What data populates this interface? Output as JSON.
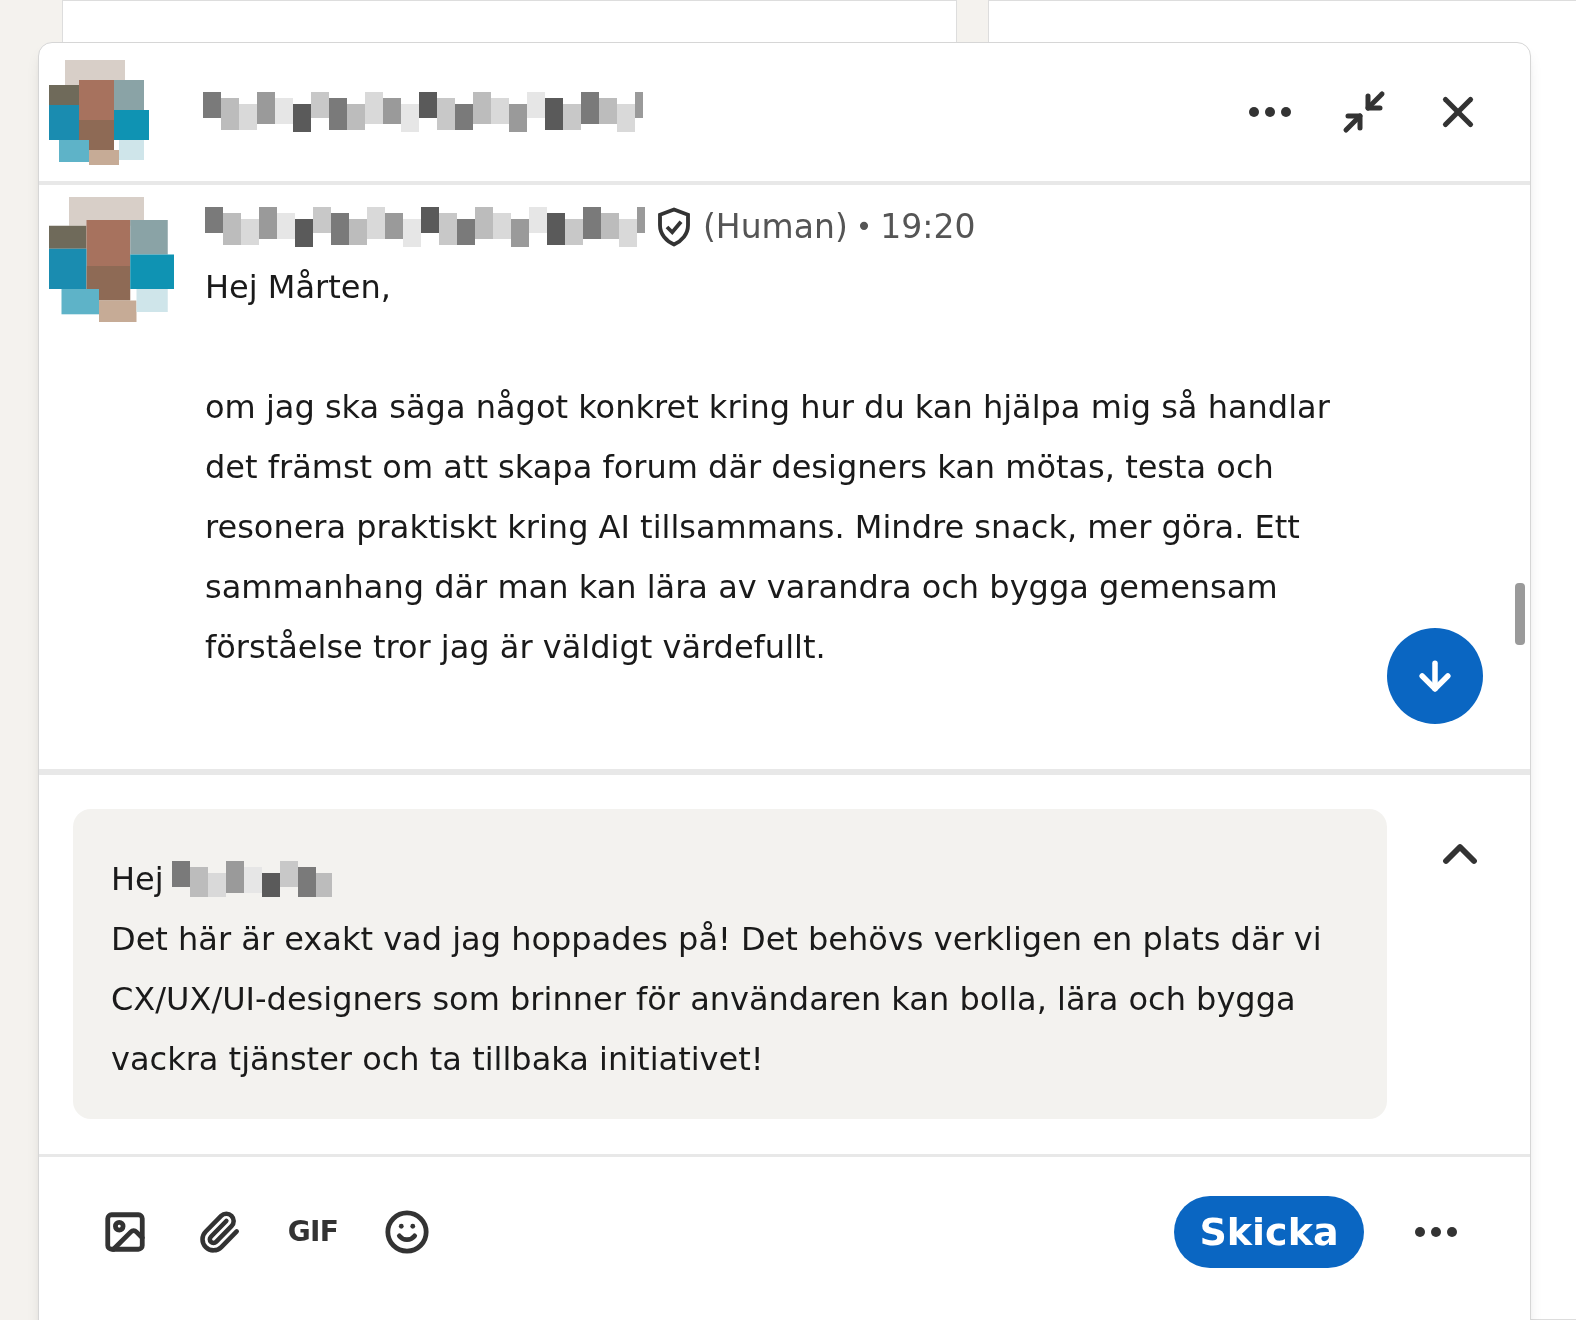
{
  "message": {
    "sender_tag": "(Human)",
    "separator": "•",
    "time": "19:20",
    "paragraphs": [
      "Hej Mårten,",
      "om jag ska säga något konkret kring hur du kan hjälpa mig så handlar det främst om att skapa forum där designers kan mötas, testa och resonera praktiskt kring AI tillsammans. Mindre snack, mer göra. Ett sammanhang där man kan lära av varandra och bygga gemensam förståelse tror jag är väldigt värdefullt."
    ]
  },
  "compose": {
    "greeting": "Hej",
    "body": "Det här är exakt vad jag hoppades på! Det behövs verkligen en plats där vi CX/UX/UI-designers som brinner för användaren kan bolla, lära och bygga vackra tjänster och ta tillbaka initiativet!"
  },
  "toolbar": {
    "gif": "GIF",
    "send": "Skicka"
  }
}
